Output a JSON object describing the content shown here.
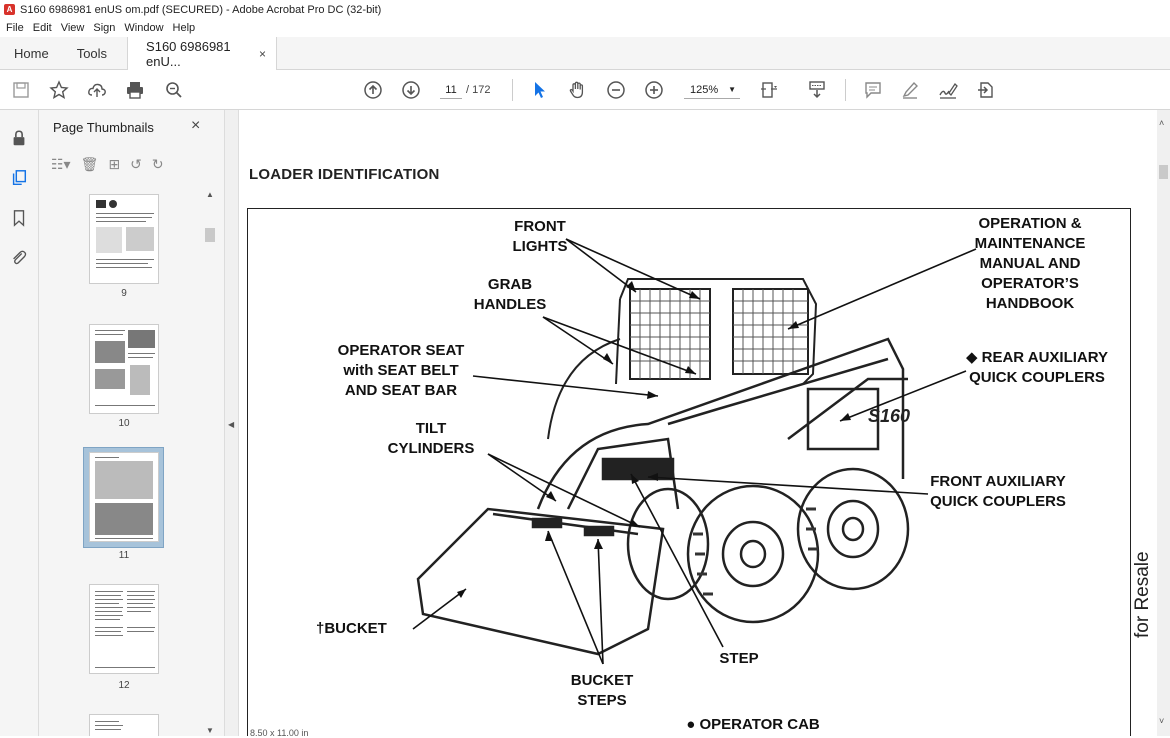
{
  "window": {
    "title": "S160 6986981 enUS om.pdf (SECURED) - Adobe Acrobat Pro DC (32-bit)"
  },
  "menu": [
    "File",
    "Edit",
    "View",
    "Sign",
    "Window",
    "Help"
  ],
  "tabs": {
    "home": "Home",
    "tools": "Tools",
    "document": "S160 6986981 enU...",
    "close": "×"
  },
  "toolbar": {
    "page_current": "11",
    "page_total": "/ 172",
    "zoom": "125%"
  },
  "panel": {
    "title": "Page Thumbnails",
    "close": "×",
    "thumbnails": [
      {
        "label": "9"
      },
      {
        "label": "10"
      },
      {
        "label": "11",
        "selected": true
      },
      {
        "label": "12"
      }
    ]
  },
  "document": {
    "heading": "LOADER IDENTIFICATION",
    "callouts": {
      "front_lights": "FRONT\nLIGHTS",
      "grab_handles": "GRAB\nHANDLES",
      "operator_seat": "OPERATOR SEAT\nwith SEAT BELT\nAND SEAT BAR",
      "tilt_cylinders": "TILT\nCYLINDERS",
      "bucket": "†BUCKET",
      "bucket_steps": "BUCKET\nSTEPS",
      "step": "STEP",
      "operator_cab": "● OPERATOR CAB",
      "manual": "OPERATION &\nMAINTENANCE\nMANUAL AND\nOPERATOR’S\nHANDBOOK",
      "rear_aux": "◆ REAR AUXILIARY\nQUICK COUPLERS",
      "front_aux": "FRONT AUXILIARY\nQUICK COUPLERS",
      "model_badge": "S160"
    },
    "watermark": "for Resale"
  },
  "status": {
    "page_size": "8.50 x 11.00 in"
  },
  "colors": {
    "accent": "#1473e6",
    "selection": "#a7c3da"
  }
}
